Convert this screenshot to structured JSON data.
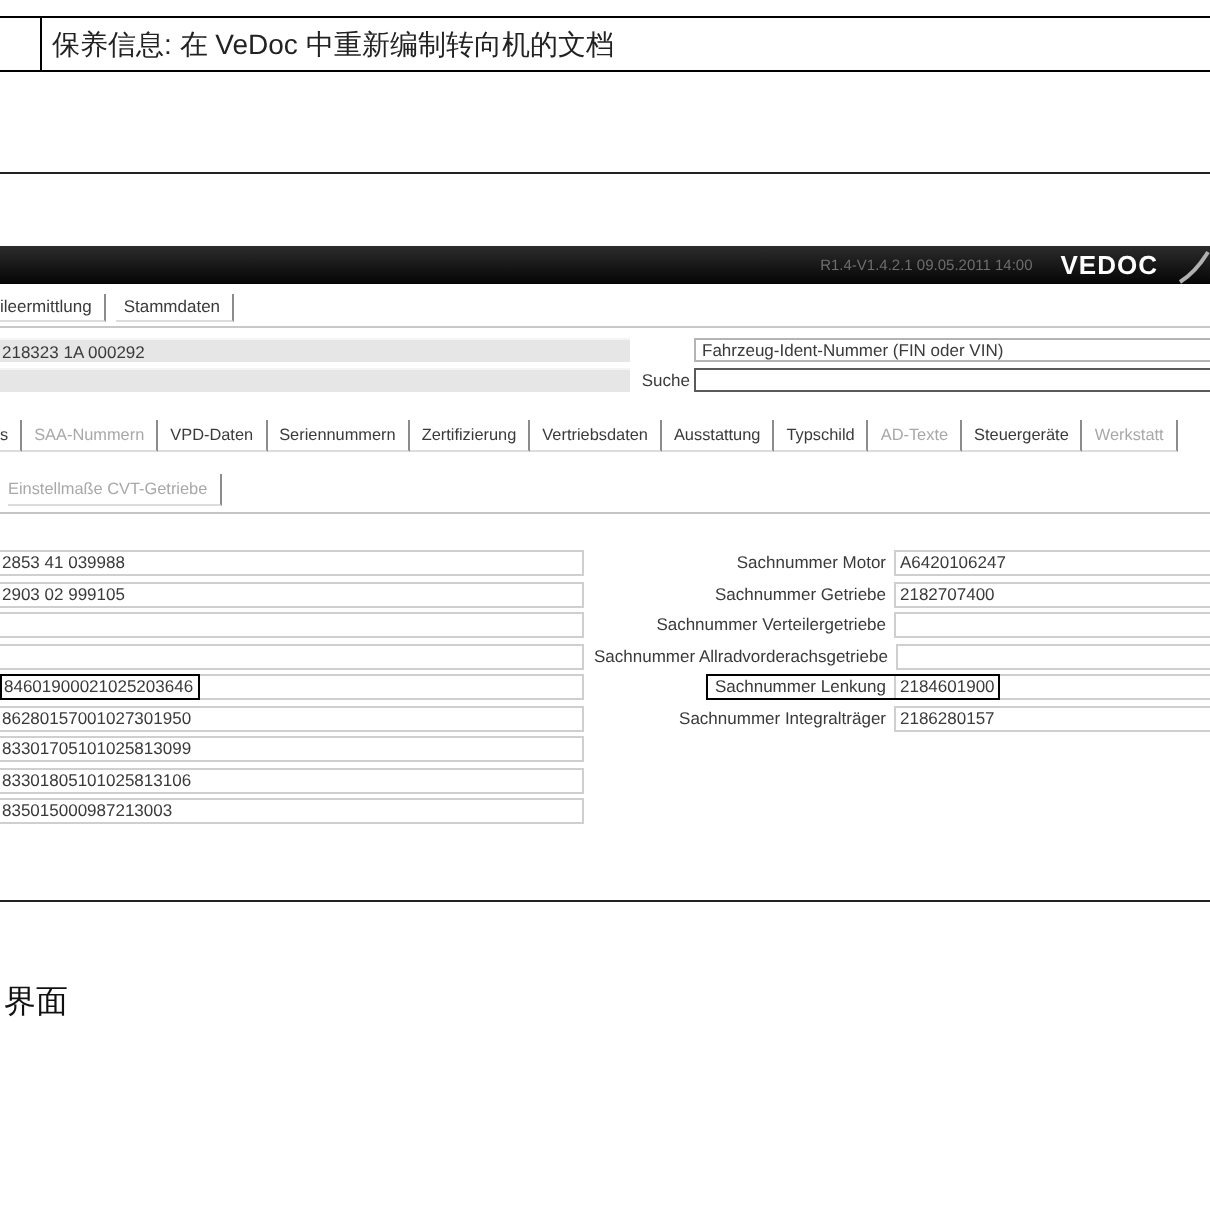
{
  "document_header": {
    "text": "保养信息: 在 VeDoc 中重新编制转向机的文档"
  },
  "screenshot": {
    "title_bar": {
      "version": "R1.4-V1.4.2.1 09.05.2011 14:00",
      "logo": "VEDOC"
    },
    "top_tabs": [
      {
        "label": "ileermittlung"
      },
      {
        "label": "Stammdaten"
      }
    ],
    "vehicle": {
      "number": "218323 1A 000292",
      "fin_field": {
        "value": "Fahrzeug-Ident-Nummer (FIN oder VIN)"
      },
      "search": {
        "label": "Suche"
      }
    },
    "main_tabs": [
      {
        "label": "s",
        "disabled": false
      },
      {
        "label": "SAA-Nummern",
        "disabled": true
      },
      {
        "label": "VPD-Daten",
        "disabled": false
      },
      {
        "label": "Seriennummern",
        "disabled": false
      },
      {
        "label": "Zertifizierung",
        "disabled": false
      },
      {
        "label": "Vertriebsdaten",
        "disabled": false
      },
      {
        "label": "Ausstattung",
        "disabled": false
      },
      {
        "label": "Typschild",
        "disabled": false
      },
      {
        "label": "AD-Texte",
        "disabled": true
      },
      {
        "label": "Steuergeräte",
        "disabled": false
      },
      {
        "label": "Werkstatt",
        "disabled": true
      }
    ],
    "sub_tabs": [
      {
        "label": "Einstellmaße CVT-Getriebe",
        "disabled": true
      }
    ],
    "fields_left": [
      {
        "value": "2853 41 039988",
        "highlighted": false
      },
      {
        "value": "2903 02 999105",
        "highlighted": false
      },
      {
        "highlighted": false
      },
      {
        "highlighted": false
      },
      {
        "value": "84601900021025203646",
        "highlighted": true
      },
      {
        "value": "86280157001027301950",
        "highlighted": false
      },
      {
        "value": "83301705101025813099",
        "highlighted": false
      },
      {
        "value": "83301805101025813106",
        "highlighted": false
      },
      {
        "value": "835015000987213003",
        "highlighted": false
      }
    ],
    "fields_right": [
      {
        "label": "Sachnummer Motor",
        "value": "A6420106247",
        "highlighted": false
      },
      {
        "label": "Sachnummer Getriebe",
        "value": "2182707400",
        "highlighted": false
      },
      {
        "label": "Sachnummer Verteilergetriebe",
        "highlighted": false
      },
      {
        "label": "Sachnummer Allradvorderachsgetriebe",
        "highlighted": false
      },
      {
        "label": "Sachnummer Lenkung",
        "value": "2184601900",
        "highlighted": true
      },
      {
        "label": "Sachnummer Integralträger",
        "value": "2186280157",
        "highlighted": false
      }
    ]
  },
  "caption": "界面"
}
